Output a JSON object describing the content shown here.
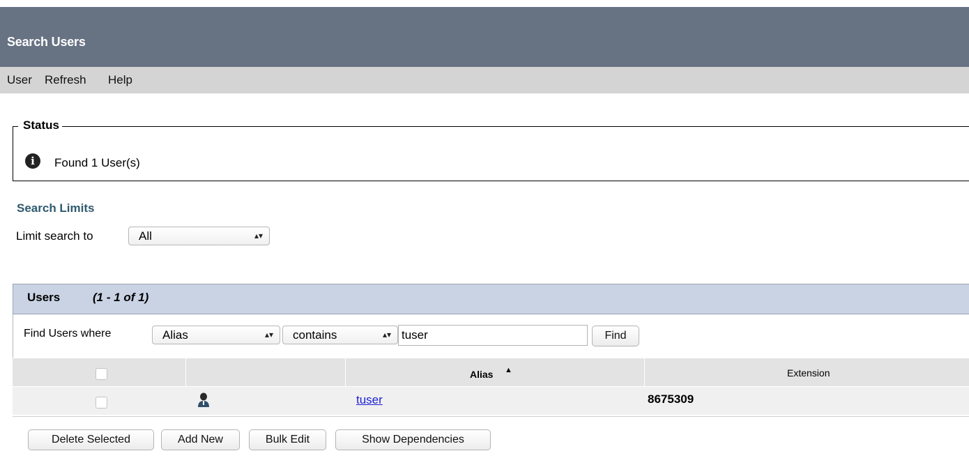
{
  "window": {
    "title": "Search Users"
  },
  "menu": {
    "items": [
      "User",
      "Refresh",
      "Help"
    ]
  },
  "status": {
    "legend": "Status",
    "message": "Found 1 User(s)",
    "icon": "info-icon"
  },
  "search_limits": {
    "heading": "Search Limits",
    "limit_label": "Limit search to",
    "limit_value": "All"
  },
  "users": {
    "title": "Users",
    "range": "(1 - 1 of 1)",
    "find_label": "Find Users where",
    "field_value": "Alias",
    "operator_value": "contains",
    "query_value": "tuser",
    "find_button": "Find",
    "columns": {
      "alias": "Alias",
      "sort_indicator": "▲",
      "extension": "Extension"
    },
    "rows": [
      {
        "alias": "tuser",
        "extension": "8675309"
      }
    ]
  },
  "actions": {
    "delete": "Delete Selected",
    "add": "Add New",
    "bulk": "Bulk Edit",
    "deps": "Show Dependencies"
  },
  "colors": {
    "titlebar": "#677283",
    "menubar": "#d4d4d4",
    "users_header": "#c9d3e4",
    "link": "#1a1fd6",
    "search_limits": "#2f5a6e"
  }
}
